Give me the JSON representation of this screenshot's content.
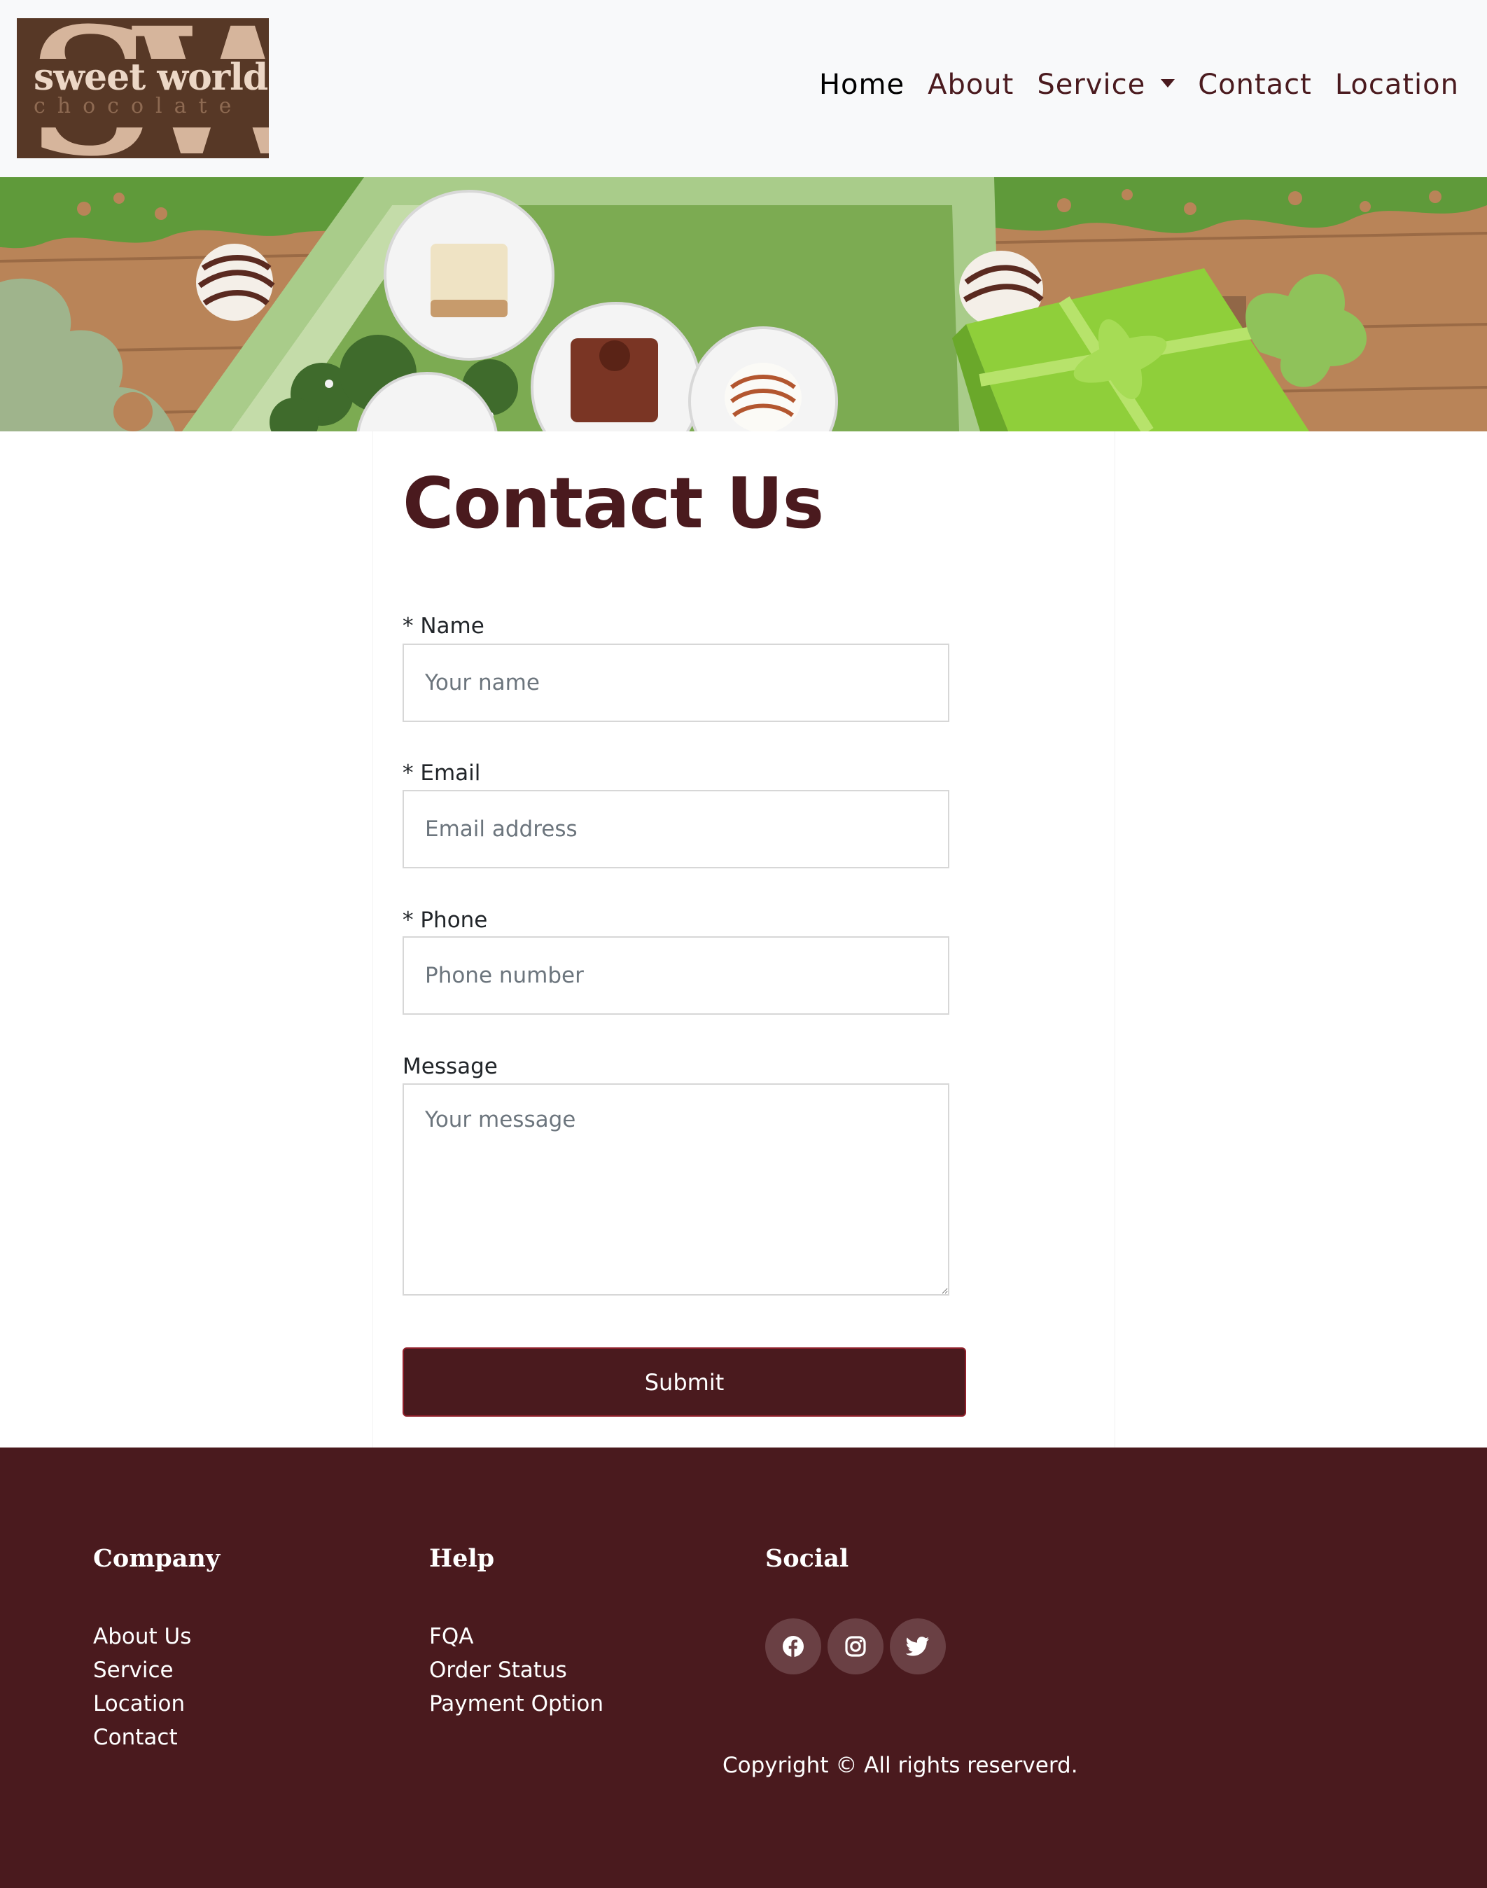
{
  "brand": {
    "monogram": "SW",
    "name": "sweet world",
    "tagline": "chocolate"
  },
  "nav": {
    "items": [
      {
        "label": "Home"
      },
      {
        "label": "About"
      },
      {
        "label": "Service"
      },
      {
        "label": "Contact"
      },
      {
        "label": "Location"
      }
    ]
  },
  "hero": {
    "description": "chocolates in paper cups on a green tray with a green gift box"
  },
  "contact": {
    "title": "Contact Us",
    "fields": {
      "name": {
        "label": "* Name",
        "placeholder": "Your name",
        "value": ""
      },
      "email": {
        "label": "* Email",
        "placeholder": "Email address",
        "value": ""
      },
      "phone": {
        "label": "* Phone",
        "placeholder": "Phone number",
        "value": ""
      },
      "message": {
        "label": "Message",
        "placeholder": "Your message",
        "value": ""
      }
    },
    "submit_label": "Submit"
  },
  "footer": {
    "company": {
      "heading": "Company",
      "links": [
        "About Us",
        "Service",
        "Location",
        "Contact"
      ]
    },
    "help": {
      "heading": "Help",
      "links": [
        "FQA",
        "Order Status",
        "Payment Option"
      ]
    },
    "social": {
      "heading": "Social",
      "icons": [
        "facebook-icon",
        "instagram-icon",
        "twitter-icon"
      ]
    },
    "copyright": "Copyright © All rights reserverd."
  },
  "colors": {
    "brand": "#4a1a1e",
    "navbar_bg": "#f8f9fa",
    "logo_bg": "#573826",
    "social_bg": "#6a4044"
  }
}
